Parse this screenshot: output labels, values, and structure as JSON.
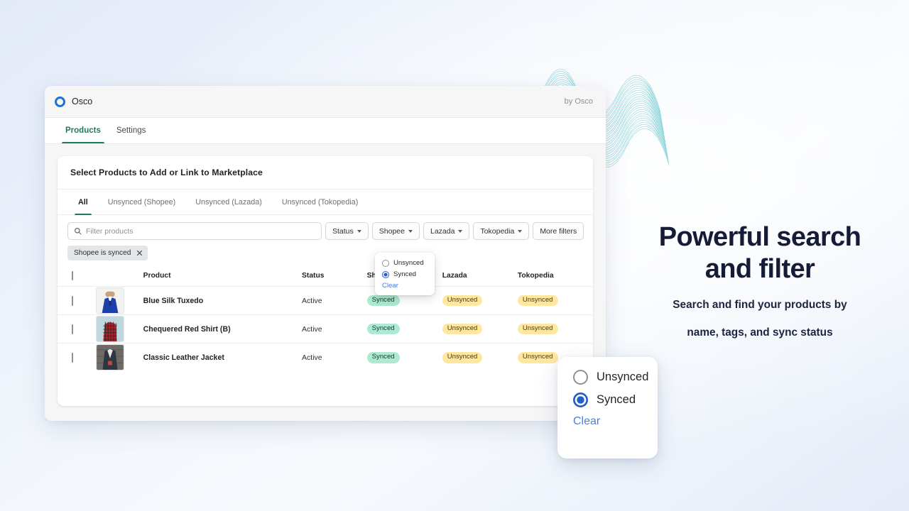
{
  "app": {
    "brand_name": "Osco",
    "by_line": "by Osco",
    "logo_color": "#1f73d4",
    "tabs": [
      {
        "label": "Products",
        "active": true
      },
      {
        "label": "Settings",
        "active": false
      }
    ]
  },
  "card": {
    "title": "Select Products to Add or Link to Marketplace",
    "filter_tabs": [
      {
        "label": "All",
        "active": true
      },
      {
        "label": "Unsynced (Shopee)",
        "active": false
      },
      {
        "label": "Unsynced (Lazada)",
        "active": false
      },
      {
        "label": "Unsynced (Tokopedia)",
        "active": false
      }
    ],
    "search": {
      "value": "",
      "placeholder": "Filter products"
    },
    "filter_buttons": [
      {
        "label": "Status",
        "has_caret": true
      },
      {
        "label": "Shopee",
        "has_caret": true
      },
      {
        "label": "Lazada",
        "has_caret": true
      },
      {
        "label": "Tokopedia",
        "has_caret": true
      },
      {
        "label": "More filters",
        "has_caret": false
      }
    ],
    "applied_chips": [
      {
        "label": "Shopee is synced"
      }
    ]
  },
  "table": {
    "headers": [
      "Product",
      "Status",
      "Shopee",
      "Lazada",
      "Tokopedia"
    ],
    "rows": [
      {
        "product": "Blue Silk Tuxedo",
        "status": "Active",
        "shopee": "Synced",
        "lazada": "Unsynced",
        "tokopedia": "Unsynced"
      },
      {
        "product": "Chequered Red Shirt (B)",
        "status": "Active",
        "shopee": "Synced",
        "lazada": "Unsynced",
        "tokopedia": "Unsynced"
      },
      {
        "product": "Classic Leather Jacket",
        "status": "Active",
        "shopee": "Synced",
        "lazada": "Unsynced",
        "tokopedia": "Unsynced"
      }
    ]
  },
  "popover": {
    "options": [
      {
        "label": "Unsynced",
        "selected": false
      },
      {
        "label": "Synced",
        "selected": true
      }
    ],
    "clear_label": "Clear"
  },
  "callout": {
    "options": [
      {
        "label": "Unsynced",
        "selected": false
      },
      {
        "label": "Synced",
        "selected": true
      }
    ],
    "clear_label": "Clear"
  },
  "promo": {
    "heading_line1": "Powerful search",
    "heading_line2": "and filter",
    "sub_line1": "Search and find your products by",
    "sub_line2": "name, tags, and sync status"
  },
  "colors": {
    "accent_green": "#1e7b55",
    "accent_blue": "#1f5fd0",
    "badge_synced_bg": "#aee9d1",
    "badge_unsynced_bg": "#ffe7a0",
    "promo_text": "#161c35"
  }
}
